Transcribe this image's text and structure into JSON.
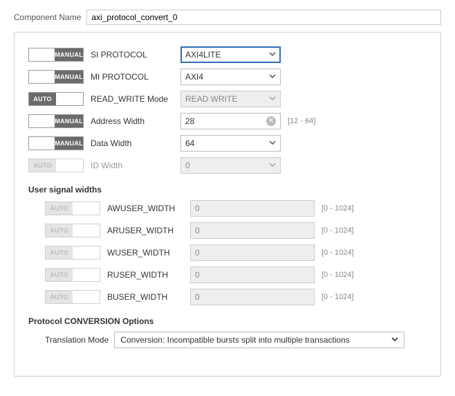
{
  "componentName": {
    "label": "Component Name",
    "value": "axi_protocol_convert_0"
  },
  "toggles": {
    "manual": "MANUAL",
    "auto": "AUTO"
  },
  "params": {
    "siProtocol": {
      "label": "SI PROTOCOL",
      "value": "AXI4LITE",
      "toggle": "manual-on",
      "focused": true
    },
    "miProtocol": {
      "label": "MI PROTOCOL",
      "value": "AXI4",
      "toggle": "manual-on"
    },
    "rwMode": {
      "label": "READ_WRITE Mode",
      "value": "READ WRITE",
      "toggle": "auto-on",
      "disabled": true
    },
    "addrWidth": {
      "label": "Address Width",
      "value": "28",
      "toggle": "manual-on",
      "hint": "[12 - 64]",
      "clear": true
    },
    "dataWidth": {
      "label": "Data Width",
      "value": "64",
      "toggle": "manual-on"
    },
    "idWidth": {
      "label": "ID Width",
      "value": "0",
      "toggle": "auto-off",
      "disabled": true,
      "labelDisabled": true
    }
  },
  "userSignals": {
    "title": "User signal widths",
    "rows": [
      {
        "label": "AWUSER_WIDTH",
        "value": "0",
        "hint": "[0 - 1024]"
      },
      {
        "label": "ARUSER_WIDTH",
        "value": "0",
        "hint": "[0 - 1024]"
      },
      {
        "label": "WUSER_WIDTH",
        "value": "0",
        "hint": "[0 - 1024]"
      },
      {
        "label": "RUSER_WIDTH",
        "value": "0",
        "hint": "[0 - 1024]"
      },
      {
        "label": "BUSER_WIDTH",
        "value": "0",
        "hint": "[0 - 1024]"
      }
    ]
  },
  "conversion": {
    "title": "Protocol CONVERSION Options",
    "label": "Translation Mode",
    "value": "Conversion: Incompatible bursts split into multiple transactions"
  }
}
